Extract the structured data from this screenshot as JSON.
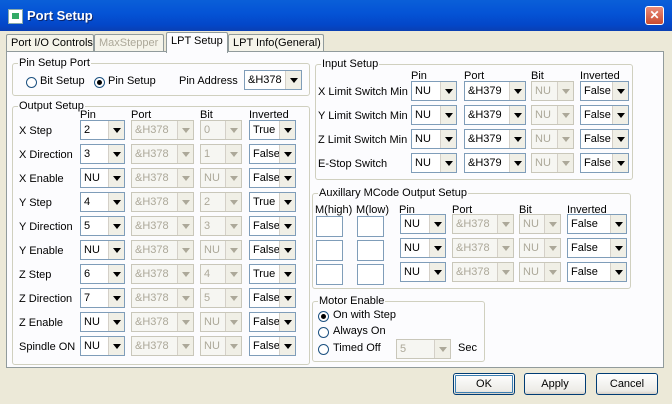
{
  "window": {
    "title": "Port Setup",
    "close_glyph": "✕"
  },
  "tabs": [
    {
      "label": "Port I/O Controls",
      "state": "normal"
    },
    {
      "label": "MaxStepper",
      "state": "disabled"
    },
    {
      "label": "LPT Setup",
      "state": "active"
    },
    {
      "label": "LPT Info(General)",
      "state": "normal"
    }
  ],
  "pin_setup": {
    "legend": "Pin Setup Port",
    "bit_label": "Bit Setup",
    "pin_label": "Pin Setup",
    "selected": "Pin Setup",
    "address_label": "Pin Address",
    "address_value": "&H378"
  },
  "output_setup": {
    "legend": "Output Setup",
    "headers": [
      "Pin",
      "Port",
      "Bit",
      "Inverted"
    ],
    "rows": [
      {
        "label": "X Step",
        "pin": "2",
        "port": "&H378",
        "bit": "0",
        "inverted": "True"
      },
      {
        "label": "X Direction",
        "pin": "3",
        "port": "&H378",
        "bit": "1",
        "inverted": "False"
      },
      {
        "label": "X Enable",
        "pin": "NU",
        "port": "&H378",
        "bit": "NU",
        "inverted": "False"
      },
      {
        "label": "Y Step",
        "pin": "4",
        "port": "&H378",
        "bit": "2",
        "inverted": "True"
      },
      {
        "label": "Y Direction",
        "pin": "5",
        "port": "&H378",
        "bit": "3",
        "inverted": "False"
      },
      {
        "label": "Y Enable",
        "pin": "NU",
        "port": "&H378",
        "bit": "NU",
        "inverted": "False"
      },
      {
        "label": "Z Step",
        "pin": "6",
        "port": "&H378",
        "bit": "4",
        "inverted": "True"
      },
      {
        "label": "Z Direction",
        "pin": "7",
        "port": "&H378",
        "bit": "5",
        "inverted": "False"
      },
      {
        "label": "Z Enable",
        "pin": "NU",
        "port": "&H378",
        "bit": "NU",
        "inverted": "False"
      },
      {
        "label": "Spindle ON",
        "pin": "NU",
        "port": "&H378",
        "bit": "NU",
        "inverted": "False"
      }
    ]
  },
  "input_setup": {
    "legend": "Input Setup",
    "headers": [
      "Pin",
      "Port",
      "Bit",
      "Inverted"
    ],
    "rows": [
      {
        "label": "X Limit Switch Min",
        "pin": "NU",
        "port": "&H379",
        "bit": "NU",
        "inverted": "False"
      },
      {
        "label": "Y Limit Switch Min",
        "pin": "NU",
        "port": "&H379",
        "bit": "NU",
        "inverted": "False"
      },
      {
        "label": "Z Limit Switch Min",
        "pin": "NU",
        "port": "&H379",
        "bit": "NU",
        "inverted": "False"
      },
      {
        "label": "E-Stop Switch",
        "pin": "NU",
        "port": "&H379",
        "bit": "NU",
        "inverted": "False"
      }
    ]
  },
  "aux_setup": {
    "legend": "Auxillary MCode Output Setup",
    "headers": [
      "M(high)",
      "M(low)",
      "Pin",
      "Port",
      "Bit",
      "Inverted"
    ],
    "rows": [
      {
        "m_high": "",
        "m_low": "",
        "pin": "NU",
        "port": "&H378",
        "bit": "NU",
        "inverted": "False"
      },
      {
        "m_high": "",
        "m_low": "",
        "pin": "NU",
        "port": "&H378",
        "bit": "NU",
        "inverted": "False"
      },
      {
        "m_high": "",
        "m_low": "",
        "pin": "NU",
        "port": "&H378",
        "bit": "NU",
        "inverted": "False"
      }
    ]
  },
  "motor_enable": {
    "legend": "Motor Enable",
    "options": [
      "On with Step",
      "Always On",
      "Timed Off"
    ],
    "selected": "On with Step",
    "timed_value": "5",
    "sec_label": "Sec"
  },
  "buttons": {
    "ok": "OK",
    "apply": "Apply",
    "cancel": "Cancel"
  }
}
